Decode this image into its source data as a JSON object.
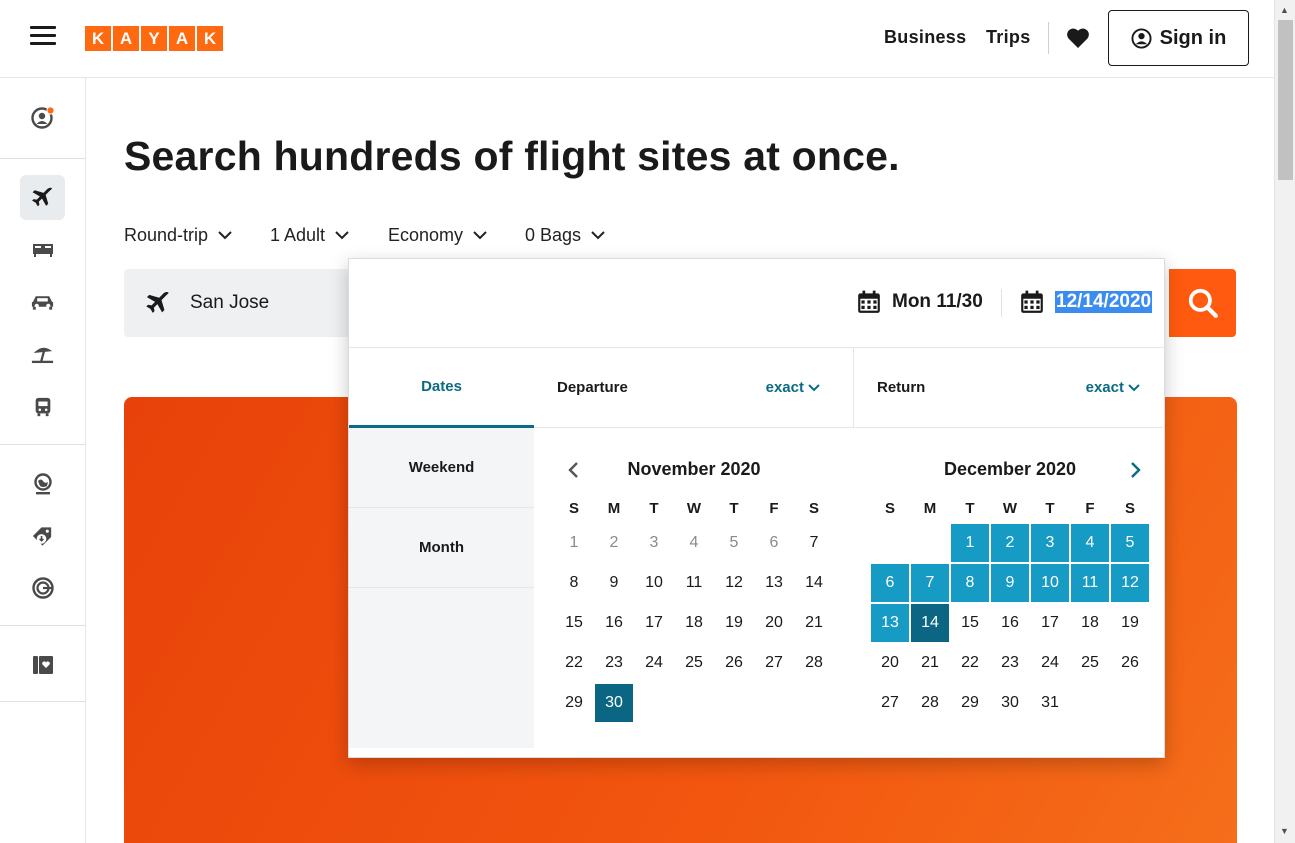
{
  "header": {
    "logo_letters": [
      "K",
      "A",
      "Y",
      "A",
      "K"
    ],
    "nav": {
      "business": "Business",
      "trips": "Trips"
    },
    "signin_label": "Sign in"
  },
  "sidebar": {
    "items": [
      "account-icon",
      "flights-icon",
      "hotels-icon",
      "cars-icon",
      "packages-icon",
      "trains-icon",
      "explore-icon",
      "deals-icon",
      "trips-icon",
      "guides-icon"
    ],
    "active": "flights-icon",
    "notification_color": "#ff690f"
  },
  "main": {
    "headline": "Search hundreds of flight sites at once.",
    "filters": {
      "trip_type": "Round-trip",
      "travelers": "1 Adult",
      "cabin": "Economy",
      "bags": "0 Bags"
    },
    "origin": "San Jose",
    "accent_color": "#ff690f"
  },
  "picker": {
    "departure_field": "Mon 11/30",
    "return_field": "12/14/2020",
    "tabs": {
      "dates": "Dates",
      "weekend": "Weekend",
      "month": "Month"
    },
    "departure_label": "Departure",
    "return_label": "Return",
    "exact_label": "exact",
    "weekdays": [
      "S",
      "M",
      "T",
      "W",
      "T",
      "F",
      "S"
    ],
    "months": [
      {
        "title": "November 2020",
        "leading_blanks": 0,
        "days": 30,
        "past_until": 6,
        "selected": [
          30
        ],
        "range": []
      },
      {
        "title": "December 2020",
        "leading_blanks": 2,
        "days": 31,
        "past_until": 0,
        "selected": [
          14
        ],
        "range": [
          1,
          2,
          3,
          4,
          5,
          6,
          7,
          8,
          9,
          10,
          11,
          12,
          13
        ]
      }
    ],
    "range_color": "#169bc4",
    "selected_color": "#0b6683"
  }
}
